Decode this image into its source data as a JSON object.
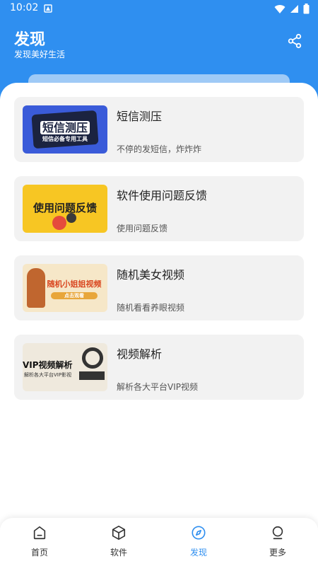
{
  "status": {
    "time": "10:02"
  },
  "header": {
    "title": "发现",
    "subtitle": "发现美好生活"
  },
  "cards": [
    {
      "title": "短信测压",
      "desc": "不停的发短信，炸炸炸",
      "thumb_text": "短信测压",
      "thumb_sub": "短信必备专用工具"
    },
    {
      "title": "软件使用问题反馈",
      "desc": "使用问题反馈",
      "thumb_text": "使用问题反馈"
    },
    {
      "title": "随机美女视频",
      "desc": "随机看看养眼视频",
      "thumb_text": "随机小姐姐视频",
      "thumb_sub": "点击观看"
    },
    {
      "title": "视频解析",
      "desc": "解析各大平台VIP视频",
      "thumb_text": "VIP视频解析",
      "thumb_sub": "解析各大平台VIP影视"
    }
  ],
  "nav": [
    {
      "label": "首页"
    },
    {
      "label": "软件"
    },
    {
      "label": "发现"
    },
    {
      "label": "更多"
    }
  ],
  "colors": {
    "accent": "#2f8ff0",
    "card_bg": "#f2f2f2"
  }
}
